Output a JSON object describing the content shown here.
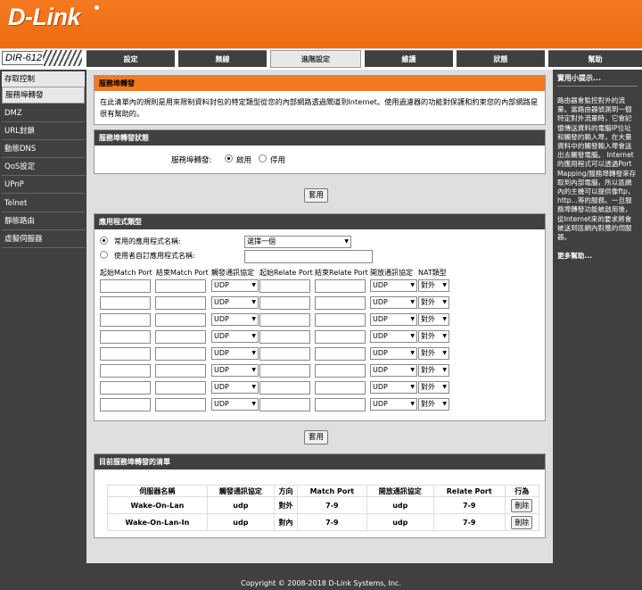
{
  "brand": "D-Link",
  "model": "DIR-612",
  "tabs": [
    "設定",
    "無線",
    "進階設定",
    "維護",
    "狀態",
    "幫助"
  ],
  "sidebar": [
    "存取控制",
    "服務埠轉發",
    "DMZ",
    "URL封鎖",
    "動態DNS",
    "QoS設定",
    "UPnP",
    "Telnet",
    "靜態路由",
    "虛擬伺服器"
  ],
  "intro": {
    "title": "服務埠轉發",
    "text": "在此清單內的規則是用來限制資料封包的特定類型從您的內部網路透過閘道到Internet。使用過濾器的功能對保護和約束您的內部網路是很有幫助的。"
  },
  "status": {
    "title": "服務埠轉發狀態",
    "label": "服務埠轉發:",
    "enable": "啟用",
    "disable": "停用"
  },
  "apply_label": "套用",
  "apptype": {
    "title": "應用程式類型",
    "common_label": "常用的應用程式名稱:",
    "custom_label": "使用者自訂應用程式名稱:",
    "select_value": "選擇一個",
    "headers": [
      "起始Match Port",
      "結束Match Port",
      "觸發通訊協定",
      "起始Relate Port",
      "結束Relate Port",
      "開放通訊協定",
      "NAT類型"
    ],
    "proto_default": "UDP",
    "nat_default": "對外",
    "row_count": 8
  },
  "list": {
    "title": "目前服務埠轉發的清單",
    "headers": [
      "伺服器名稱",
      "觸發通訊協定",
      "方向",
      "Match Port",
      "開放通訊協定",
      "Relate Port",
      "行為"
    ],
    "rows": [
      {
        "name": "Wake-On-Lan",
        "trigger": "udp",
        "dir": "對外",
        "match": "7-9",
        "open": "udp",
        "relate": "7-9",
        "action": "刪除"
      },
      {
        "name": "Wake-On-Lan-In",
        "trigger": "udp",
        "dir": "對內",
        "match": "7-9",
        "open": "udp",
        "relate": "7-9",
        "action": "刪除"
      }
    ]
  },
  "help": {
    "title": "實用小提示...",
    "text": "路由器會監控對外的流量。當路由器偵測到一個特定對外流量時，它會記憶傳送資料的電腦IP位址和觸發的輸入埠，在大量資料中的觸發輸入埠會送出去觸發電腦。 Internet的應用程式可以透過Port Mapping/服務埠轉發來存取到內部電腦，所以區網內的主機可以提供像ftp，http...等的服務。一旦服務埠轉發功能被啟用後，從Internet來的要求將會被送到區網內對應的伺服器。",
    "more": "更多幫助..."
  },
  "footer": "Copyright © 2008-2018 D-Link Systems, Inc."
}
